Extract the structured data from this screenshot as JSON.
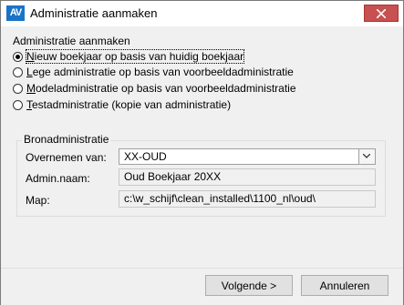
{
  "window": {
    "title": "Administratie aanmaken"
  },
  "app_icon": {
    "text": "AV"
  },
  "options_group": {
    "caption": "Administratie aanmaken",
    "options": [
      {
        "mnemonic": "N",
        "rest": "ieuw boekjaar op basis van huidig boekjaar",
        "checked": true
      },
      {
        "mnemonic": "L",
        "rest": "ege administratie op basis van voorbeeldadministratie",
        "checked": false
      },
      {
        "mnemonic": "M",
        "rest": "odeladministratie op basis van voorbeeldadministratie",
        "checked": false
      },
      {
        "mnemonic": "T",
        "rest": "estadministratie (kopie van administratie)",
        "checked": false
      }
    ]
  },
  "source": {
    "caption": "Bronadministratie",
    "overnemen_label": "Overnemen van:",
    "overnemen_value": "XX-OUD",
    "admin_naam_label": "Admin.naam:",
    "admin_naam_value": "Oud Boekjaar 20XX",
    "map_label": "Map:",
    "map_value": "c:\\w_schijf\\clean_installed\\1100_nl\\oud\\"
  },
  "buttons": {
    "next": "Volgende >",
    "cancel": "Annuleren"
  },
  "colors": {
    "close_button": "#c75050",
    "app_icon": "#1b73c7"
  }
}
